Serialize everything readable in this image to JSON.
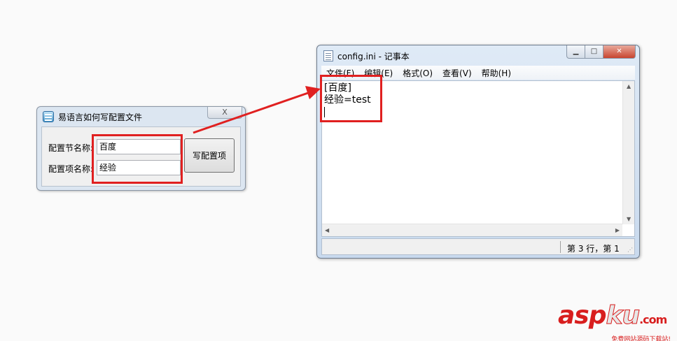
{
  "dialog": {
    "title": "易语言如何写配置文件",
    "close_glyph": "X",
    "section_label": "配置节名称:",
    "section_value": "百度",
    "item_label": "配置项名称:",
    "item_value": "经验",
    "write_button": "写配置项"
  },
  "notepad": {
    "title": "config.ini - 记事本",
    "menu": [
      "文件(F)",
      "编辑(E)",
      "格式(O)",
      "查看(V)",
      "帮助(H)"
    ],
    "lines": [
      "[百度]",
      "经验=test"
    ],
    "status": "第 3 行，第 1",
    "controls": {
      "minimize_icon": "minimize-icon",
      "maximize_icon": "maximize-icon",
      "close_icon": "close-icon"
    }
  },
  "annotation": {
    "color": "#e02020"
  },
  "watermark": {
    "brand_a": "asp",
    "brand_b": "ku",
    "brand_c": ".com",
    "tagline": "免费网站源码下载站!"
  }
}
